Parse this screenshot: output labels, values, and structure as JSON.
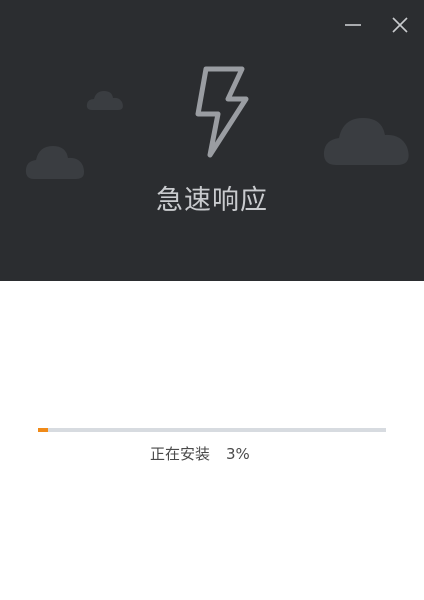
{
  "banner": {
    "title": "急速响应",
    "icon": "lightning-bolt-icon",
    "background": "#2b2d30"
  },
  "window_controls": {
    "minimize_icon": "minimize-icon",
    "close_icon": "close-icon"
  },
  "install": {
    "status_text": "正在安装",
    "percent_text": "3%",
    "progress_fraction": 0.03,
    "progress_color": "#f08a18"
  }
}
